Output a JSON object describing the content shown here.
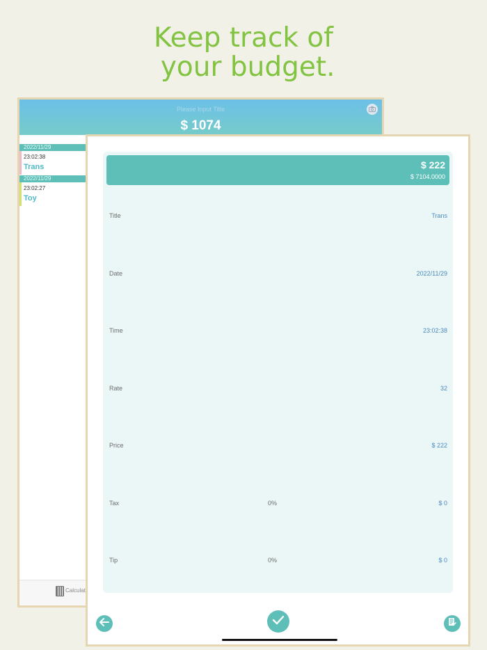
{
  "headline": {
    "line1": "Keep track of",
    "line2": " your budget."
  },
  "back_screen": {
    "title_placeholder": "Please Input Title",
    "total": "$ 1074",
    "items": [
      {
        "date": "2022/11/29",
        "time": "23:02:38",
        "title": "Trans"
      },
      {
        "date": "2022/11/29",
        "time": "23:02:27",
        "title": "Toy"
      }
    ],
    "bottom": {
      "calculator_label": "Calculato"
    }
  },
  "detail": {
    "summary": {
      "price": "$ 222",
      "sub": "$ 7104.0000"
    },
    "rows": [
      {
        "label": "Title",
        "value": "Trans",
        "percent": ""
      },
      {
        "label": "Date",
        "value": "2022/11/29",
        "percent": ""
      },
      {
        "label": "Time",
        "value": "23:02:38",
        "percent": ""
      },
      {
        "label": "Rate",
        "value": "32",
        "percent": ""
      },
      {
        "label": "Price",
        "value": "$ 222",
        "percent": ""
      },
      {
        "label": "Tax",
        "value": "$ 0",
        "percent": "0%"
      },
      {
        "label": "Tip",
        "value": "$ 0",
        "percent": "0%"
      }
    ]
  },
  "colors": {
    "headline": "#82c341",
    "accent": "#5dbfb8",
    "frame": "#e6d5b3",
    "value_text": "#4c8ac0"
  },
  "icons": [
    "camera-icon",
    "calculator-icon",
    "back-arrow-icon",
    "confirm-check-icon",
    "notes-icon"
  ]
}
